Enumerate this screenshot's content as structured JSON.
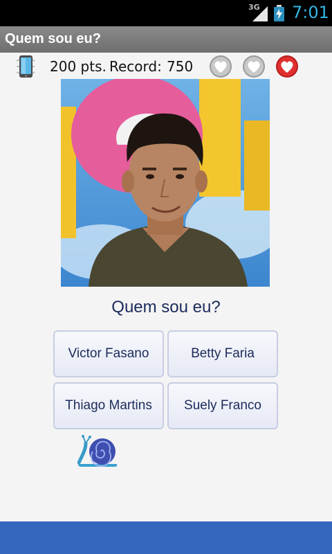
{
  "status_bar": {
    "network": "3G",
    "time": "7:01"
  },
  "titlebar": {
    "title": "Quem sou eu?"
  },
  "scoreboard": {
    "points": "200 pts.",
    "record_label": "Record:",
    "record_value": "750",
    "lives_total": 3,
    "lives_lost": 2
  },
  "question": "Quem sou eu?",
  "answers": [
    "Victor Fasano",
    "Betty Faria",
    "Thiago Martins",
    "Suely Franco"
  ],
  "icons": {
    "phone": "phone-icon",
    "heart_lost": "heart-gray-icon",
    "heart_life": "heart-red-icon",
    "snail": "snail-icon"
  },
  "colors": {
    "title_bar": "#7c7c7c",
    "text": "#1b2a5a",
    "bottom_bar": "#3467bd",
    "status_time": "#33b5e5",
    "heart_life": "#e03030"
  }
}
